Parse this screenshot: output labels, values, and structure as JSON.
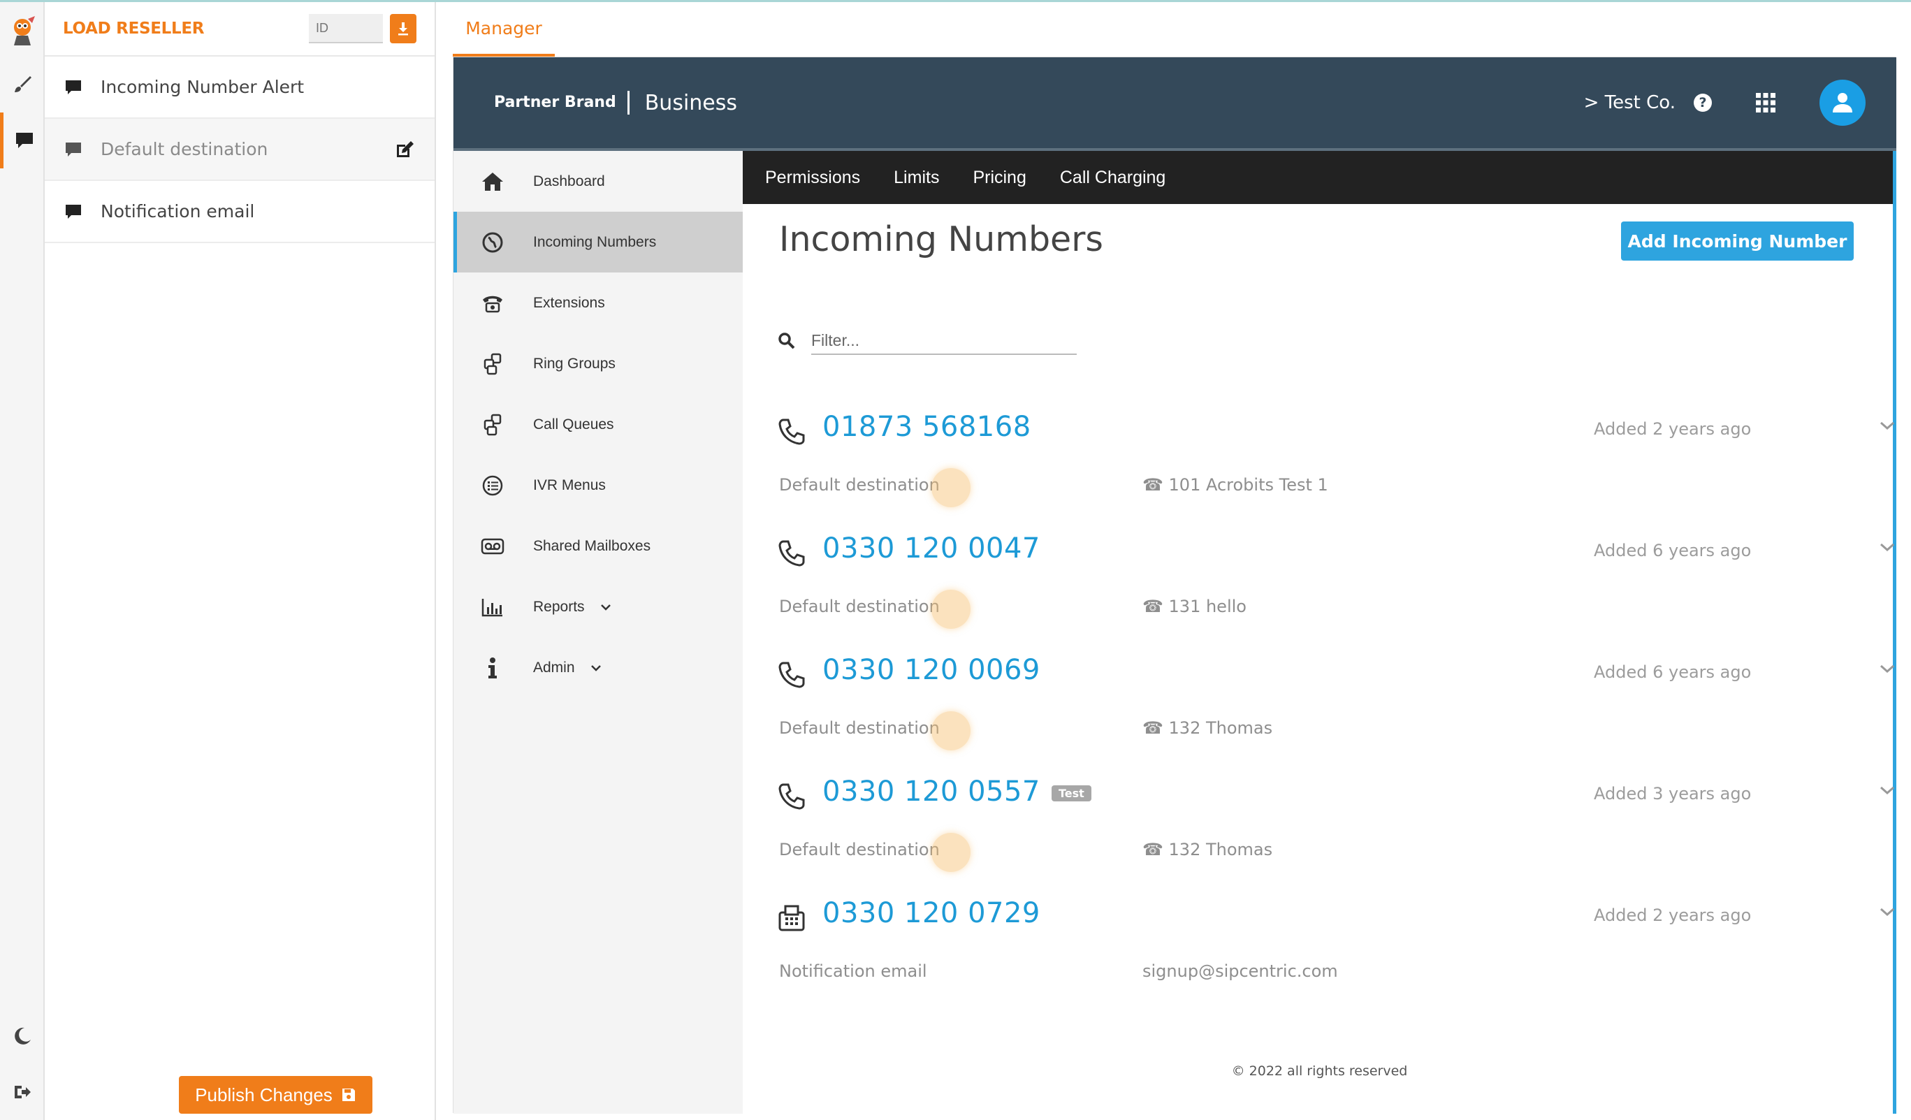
{
  "editor": {
    "title": "LOAD RESELLER",
    "id_placeholder": "ID",
    "items": [
      {
        "label": "Incoming Number Alert"
      },
      {
        "label": "Default destination"
      },
      {
        "label": "Notification email"
      }
    ],
    "publish_label": "Publish Changes"
  },
  "manager_tab": "Manager",
  "topbar": {
    "brand": "Partner Brand",
    "product": "Business",
    "company": "> Test Co.",
    "help": "?"
  },
  "nav": {
    "items": [
      {
        "label": "Dashboard",
        "icon": "home-icon"
      },
      {
        "label": "Incoming Numbers",
        "icon": "globe-icon",
        "active": true
      },
      {
        "label": "Extensions",
        "icon": "telephone-icon"
      },
      {
        "label": "Ring Groups",
        "icon": "ring-groups-icon"
      },
      {
        "label": "Call Queues",
        "icon": "call-queues-icon"
      },
      {
        "label": "IVR Menus",
        "icon": "list-icon"
      },
      {
        "label": "Shared Mailboxes",
        "icon": "voicemail-icon"
      },
      {
        "label": "Reports",
        "icon": "bar-chart-icon"
      },
      {
        "label": "Admin",
        "icon": "info-icon"
      }
    ]
  },
  "subnav": [
    "Permissions",
    "Limits",
    "Pricing",
    "Call Charging"
  ],
  "page": {
    "title": "Incoming Numbers",
    "add_button": "Add Incoming Number",
    "filter_placeholder": "Filter..."
  },
  "numbers": [
    {
      "number": "01873 568168",
      "badge": "",
      "added": "Added 2 years ago",
      "label": "Default destination",
      "value": "☎ 101 Acrobits Test 1",
      "icon": "phone-icon"
    },
    {
      "number": "0330 120 0047",
      "badge": "",
      "added": "Added 6 years ago",
      "label": "Default destination",
      "value": "☎ 131 hello",
      "icon": "phone-icon"
    },
    {
      "number": "0330 120 0069",
      "badge": "",
      "added": "Added 6 years ago",
      "label": "Default destination",
      "value": "☎ 132 Thomas",
      "icon": "phone-icon"
    },
    {
      "number": "0330 120 0557",
      "badge": "Test",
      "added": "Added 3 years ago",
      "label": "Default destination",
      "value": "☎ 132 Thomas",
      "icon": "phone-icon"
    },
    {
      "number": "0330 120 0729",
      "badge": "",
      "added": "Added 2 years ago",
      "label": "Notification email",
      "value": "signup@sipcentric.com",
      "icon": "fax-icon"
    }
  ],
  "footer": "© 2022 all rights reserved",
  "colors": {
    "accent": "#f07d1a",
    "link": "#1d9ad6",
    "topbar": "#34495a",
    "subnav": "#222222",
    "button": "#2ea4df"
  }
}
